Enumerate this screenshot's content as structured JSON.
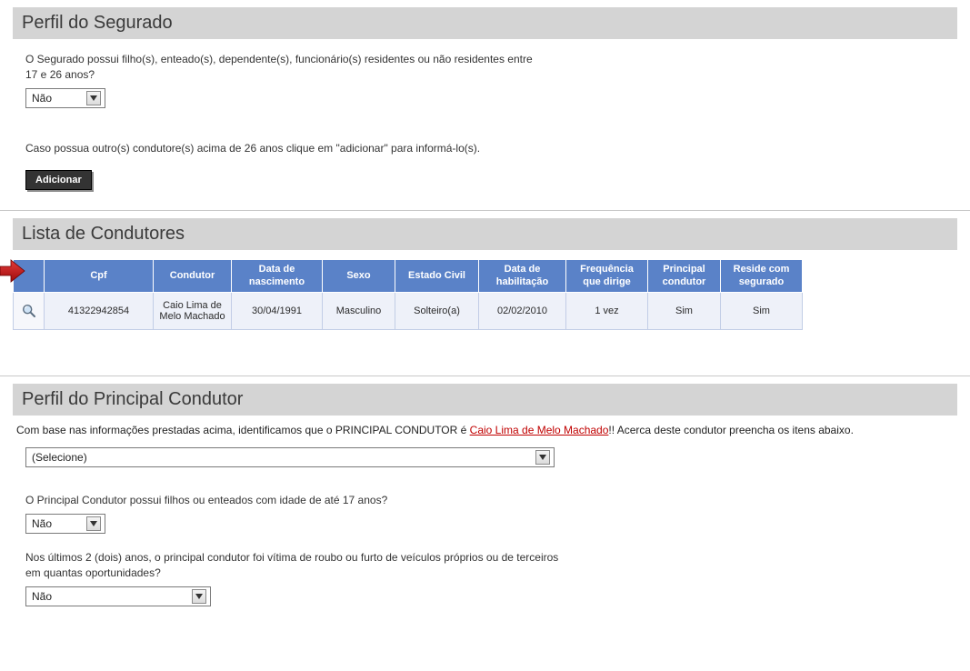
{
  "perfil_segurado": {
    "title": "Perfil do Segurado",
    "q_filhos": "O Segurado possui filho(s), enteado(s), dependente(s), funcionário(s) residentes ou não residentes entre 17 e 26 anos?",
    "filhos_value": "Não",
    "cond_note": "Caso possua outro(s) condutore(s) acima de 26 anos clique em \"adicionar\" para informá-lo(s).",
    "add_button": "Adicionar"
  },
  "lista": {
    "title": "Lista de Condutores",
    "headers": {
      "cpf": "Cpf",
      "condutor": "Condutor",
      "nasc": "Data de nascimento",
      "sexo": "Sexo",
      "civil": "Estado Civil",
      "habil": "Data de habilitação",
      "freq": "Frequência que dirige",
      "principal": "Principal condutor",
      "reside": "Reside com segurado"
    },
    "row": {
      "cpf": "41322942854",
      "condutor": "Caio Lima de Melo Machado",
      "nasc": "30/04/1991",
      "sexo": "Masculino",
      "civil": "Solteiro(a)",
      "habil": "02/02/2010",
      "freq": "1 vez",
      "principal": "Sim",
      "reside": "Sim"
    }
  },
  "principal": {
    "title": "Perfil do Principal Condutor",
    "intro_before": "Com base nas informações prestadas acima, identificamos que o PRINCIPAL CONDUTOR é ",
    "driver_link": "Caio Lima de Melo Machado",
    "intro_after": "!! Acerca deste condutor preencha os itens abaixo.",
    "select_value": "(Selecione)",
    "q_filhos17": "O Principal Condutor possui filhos ou enteados com idade de até 17 anos?",
    "filhos17_value": "Não",
    "q_roubo": "Nos últimos 2 (dois) anos, o principal condutor foi vítima de roubo ou furto de veículos próprios ou de terceiros em quantas oportunidades?",
    "roubo_value": "Não"
  }
}
